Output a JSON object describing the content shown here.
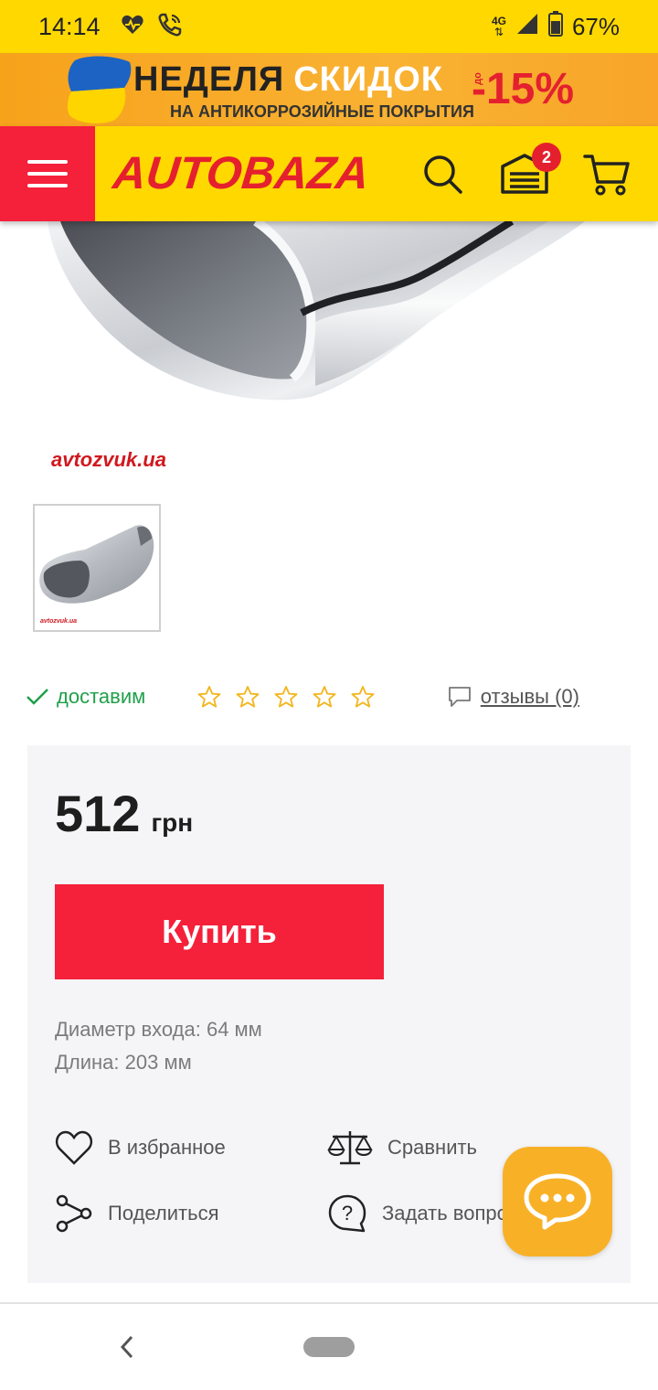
{
  "status_bar": {
    "time": "14:14",
    "network": "4G",
    "battery": "67%"
  },
  "promo": {
    "title_word1": "НЕДЕЛЯ",
    "title_word2": "СКИДОК",
    "subtitle": "НА АНТИКОРРОЗИЙНЫЕ ПОКРЫТИЯ",
    "prefix": "до",
    "discount": "-15%"
  },
  "header": {
    "logo": "AUTOBAZA",
    "garage_badge": "2"
  },
  "product": {
    "watermark": "avtozvuk.ua",
    "thumb_watermark": "avtozvuk.ua",
    "delivery": "доставим",
    "rating": 0,
    "rating_max": 5,
    "reviews_label": "отзывы (0)"
  },
  "price_card": {
    "price": "512",
    "currency": "грн",
    "buy_label": "Купить",
    "spec_diameter": "Диаметр входа: 64 мм",
    "spec_length": "Длина: 203 мм",
    "favorite_label": "В избранное",
    "compare_label": "Сравнить",
    "share_label": "Поделиться",
    "ask_label": "Задать вопрос"
  },
  "colors": {
    "brand_yellow": "#ffd800",
    "brand_red": "#f5203a",
    "delivery_green": "#20a04a",
    "chat_orange": "#f8b127"
  }
}
